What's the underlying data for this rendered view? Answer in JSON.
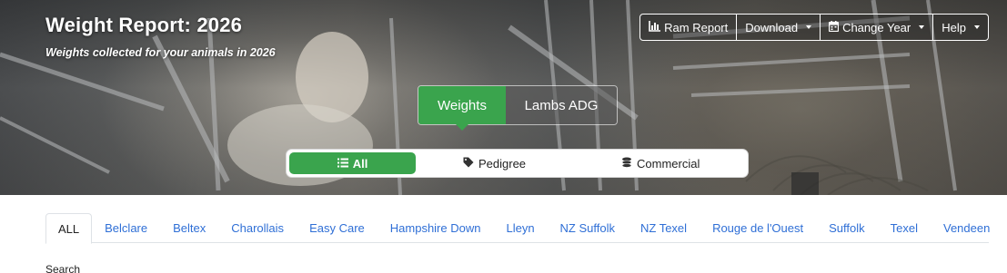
{
  "header": {
    "title": "Weight Report: 2026",
    "subtitle": "Weights collected for your animals in 2026"
  },
  "toolbar": {
    "ram_report": "Ram Report",
    "download": "Download",
    "change_year": "Change Year",
    "help": "Help"
  },
  "view_toggle": {
    "weights": "Weights",
    "lambs_adg": "Lambs ADG"
  },
  "filter": {
    "all": "All",
    "pedigree": "Pedigree",
    "commercial": "Commercial"
  },
  "breed_tabs": [
    "ALL",
    "Belclare",
    "Beltex",
    "Charollais",
    "Easy Care",
    "Hampshire Down",
    "Lleyn",
    "NZ Suffolk",
    "NZ Texel",
    "Rouge de l'Ouest",
    "Suffolk",
    "Texel",
    "Vendeen"
  ],
  "search": {
    "label": "Search"
  },
  "colors": {
    "accent": "#3aa44d",
    "link": "#2f6fd6"
  }
}
